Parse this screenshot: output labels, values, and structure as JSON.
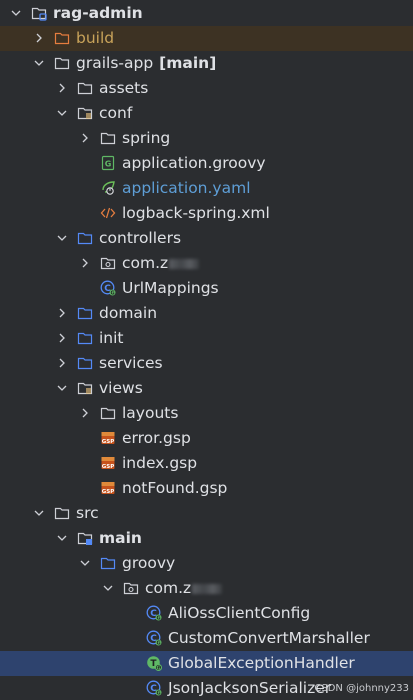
{
  "tree": {
    "items": [
      {
        "label": "rag-admin",
        "depth": 0,
        "arrow": "down",
        "icon": "module-folder",
        "style": "bold"
      },
      {
        "label": "build",
        "depth": 1,
        "arrow": "right",
        "icon": "folder-excluded",
        "style": "excluded"
      },
      {
        "label": "grails-app",
        "branch": "[main]",
        "depth": 1,
        "arrow": "down",
        "icon": "folder"
      },
      {
        "label": "assets",
        "depth": 2,
        "arrow": "right",
        "icon": "folder"
      },
      {
        "label": "conf",
        "depth": 2,
        "arrow": "down",
        "icon": "folder-resources"
      },
      {
        "label": "spring",
        "depth": 3,
        "arrow": "right",
        "icon": "folder"
      },
      {
        "label": "application.groovy",
        "depth": 3,
        "icon": "groovy-file"
      },
      {
        "label": "application.yaml",
        "depth": 3,
        "icon": "spring-boot-file",
        "style": "yaml"
      },
      {
        "label": "logback-spring.xml",
        "depth": 3,
        "icon": "xml-file"
      },
      {
        "label": "controllers",
        "depth": 2,
        "arrow": "down",
        "icon": "folder-source"
      },
      {
        "label": "com.z",
        "depth": 3,
        "arrow": "right",
        "icon": "package",
        "redacted": true
      },
      {
        "label": "UrlMappings",
        "depth": 3,
        "icon": "groovy-class"
      },
      {
        "label": "domain",
        "depth": 2,
        "arrow": "right",
        "icon": "folder-source"
      },
      {
        "label": "init",
        "depth": 2,
        "arrow": "right",
        "icon": "folder-source"
      },
      {
        "label": "services",
        "depth": 2,
        "arrow": "right",
        "icon": "folder-source"
      },
      {
        "label": "views",
        "depth": 2,
        "arrow": "down",
        "icon": "folder-resources"
      },
      {
        "label": "layouts",
        "depth": 3,
        "arrow": "right",
        "icon": "folder"
      },
      {
        "label": "error.gsp",
        "depth": 3,
        "icon": "gsp-file"
      },
      {
        "label": "index.gsp",
        "depth": 3,
        "icon": "gsp-file"
      },
      {
        "label": "notFound.gsp",
        "depth": 3,
        "icon": "gsp-file"
      },
      {
        "label": "src",
        "depth": 1,
        "arrow": "down",
        "icon": "folder"
      },
      {
        "label": "main",
        "depth": 2,
        "arrow": "down",
        "icon": "folder-module",
        "style": "bold"
      },
      {
        "label": "groovy",
        "depth": 3,
        "arrow": "down",
        "icon": "folder-source"
      },
      {
        "label": "com.z",
        "depth": 4,
        "arrow": "down",
        "icon": "package",
        "redacted": true
      },
      {
        "label": "AliOssClientConfig",
        "depth": 5,
        "icon": "groovy-class"
      },
      {
        "label": "CustomConvertMarshaller",
        "depth": 5,
        "icon": "groovy-class"
      },
      {
        "label": "GlobalExceptionHandler",
        "depth": 5,
        "icon": "groovy-trait",
        "selected": true
      },
      {
        "label": "JsonJacksonSerializer",
        "depth": 5,
        "icon": "groovy-class"
      }
    ]
  },
  "colors": {
    "background": "#2b2d30",
    "text": "#dfe1e5",
    "excluded_text": "#c8a35a",
    "yaml_text": "#5e9ed6",
    "selection": "#2e436e",
    "folder_outline": "#ced0d6",
    "source_folder_outline": "#548af7"
  },
  "watermark": "CSDN @johnny233"
}
